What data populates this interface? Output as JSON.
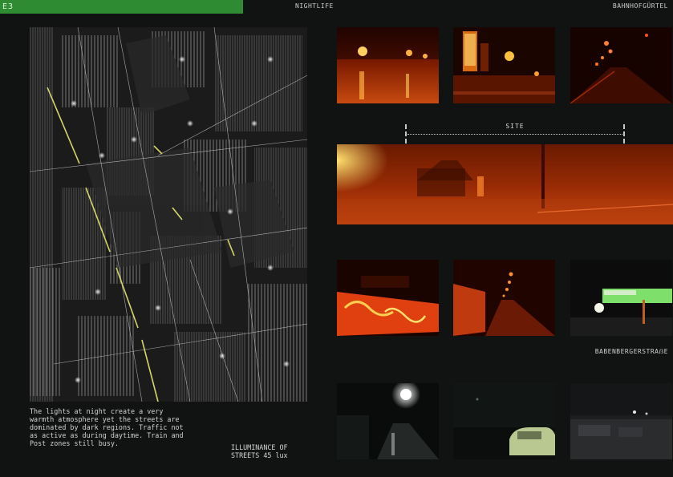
{
  "header": {
    "tag": "E3",
    "section": "NIGHTLIFE",
    "place": "BAHNHOFGÜRTEL"
  },
  "colors": {
    "tag_bg": "#2f8b32",
    "background": "#111312",
    "street_light": "#d8d66a",
    "sodium_glow": "#ff7a1a"
  },
  "map": {
    "name": "night-streetlight-map"
  },
  "caption": {
    "text": "The lights at night create a very\nwarmth atmosphere yet the streets are\ndominated by dark regions. Traffic not\nas active as during daytime. Train and\nPost zones still busy."
  },
  "illuminance": {
    "text": "ILLUMINANCE OF\nSTREETS 45 lux"
  },
  "site": {
    "label": "SITE"
  },
  "street_label": "BABENBERGERSTRAẞE"
}
